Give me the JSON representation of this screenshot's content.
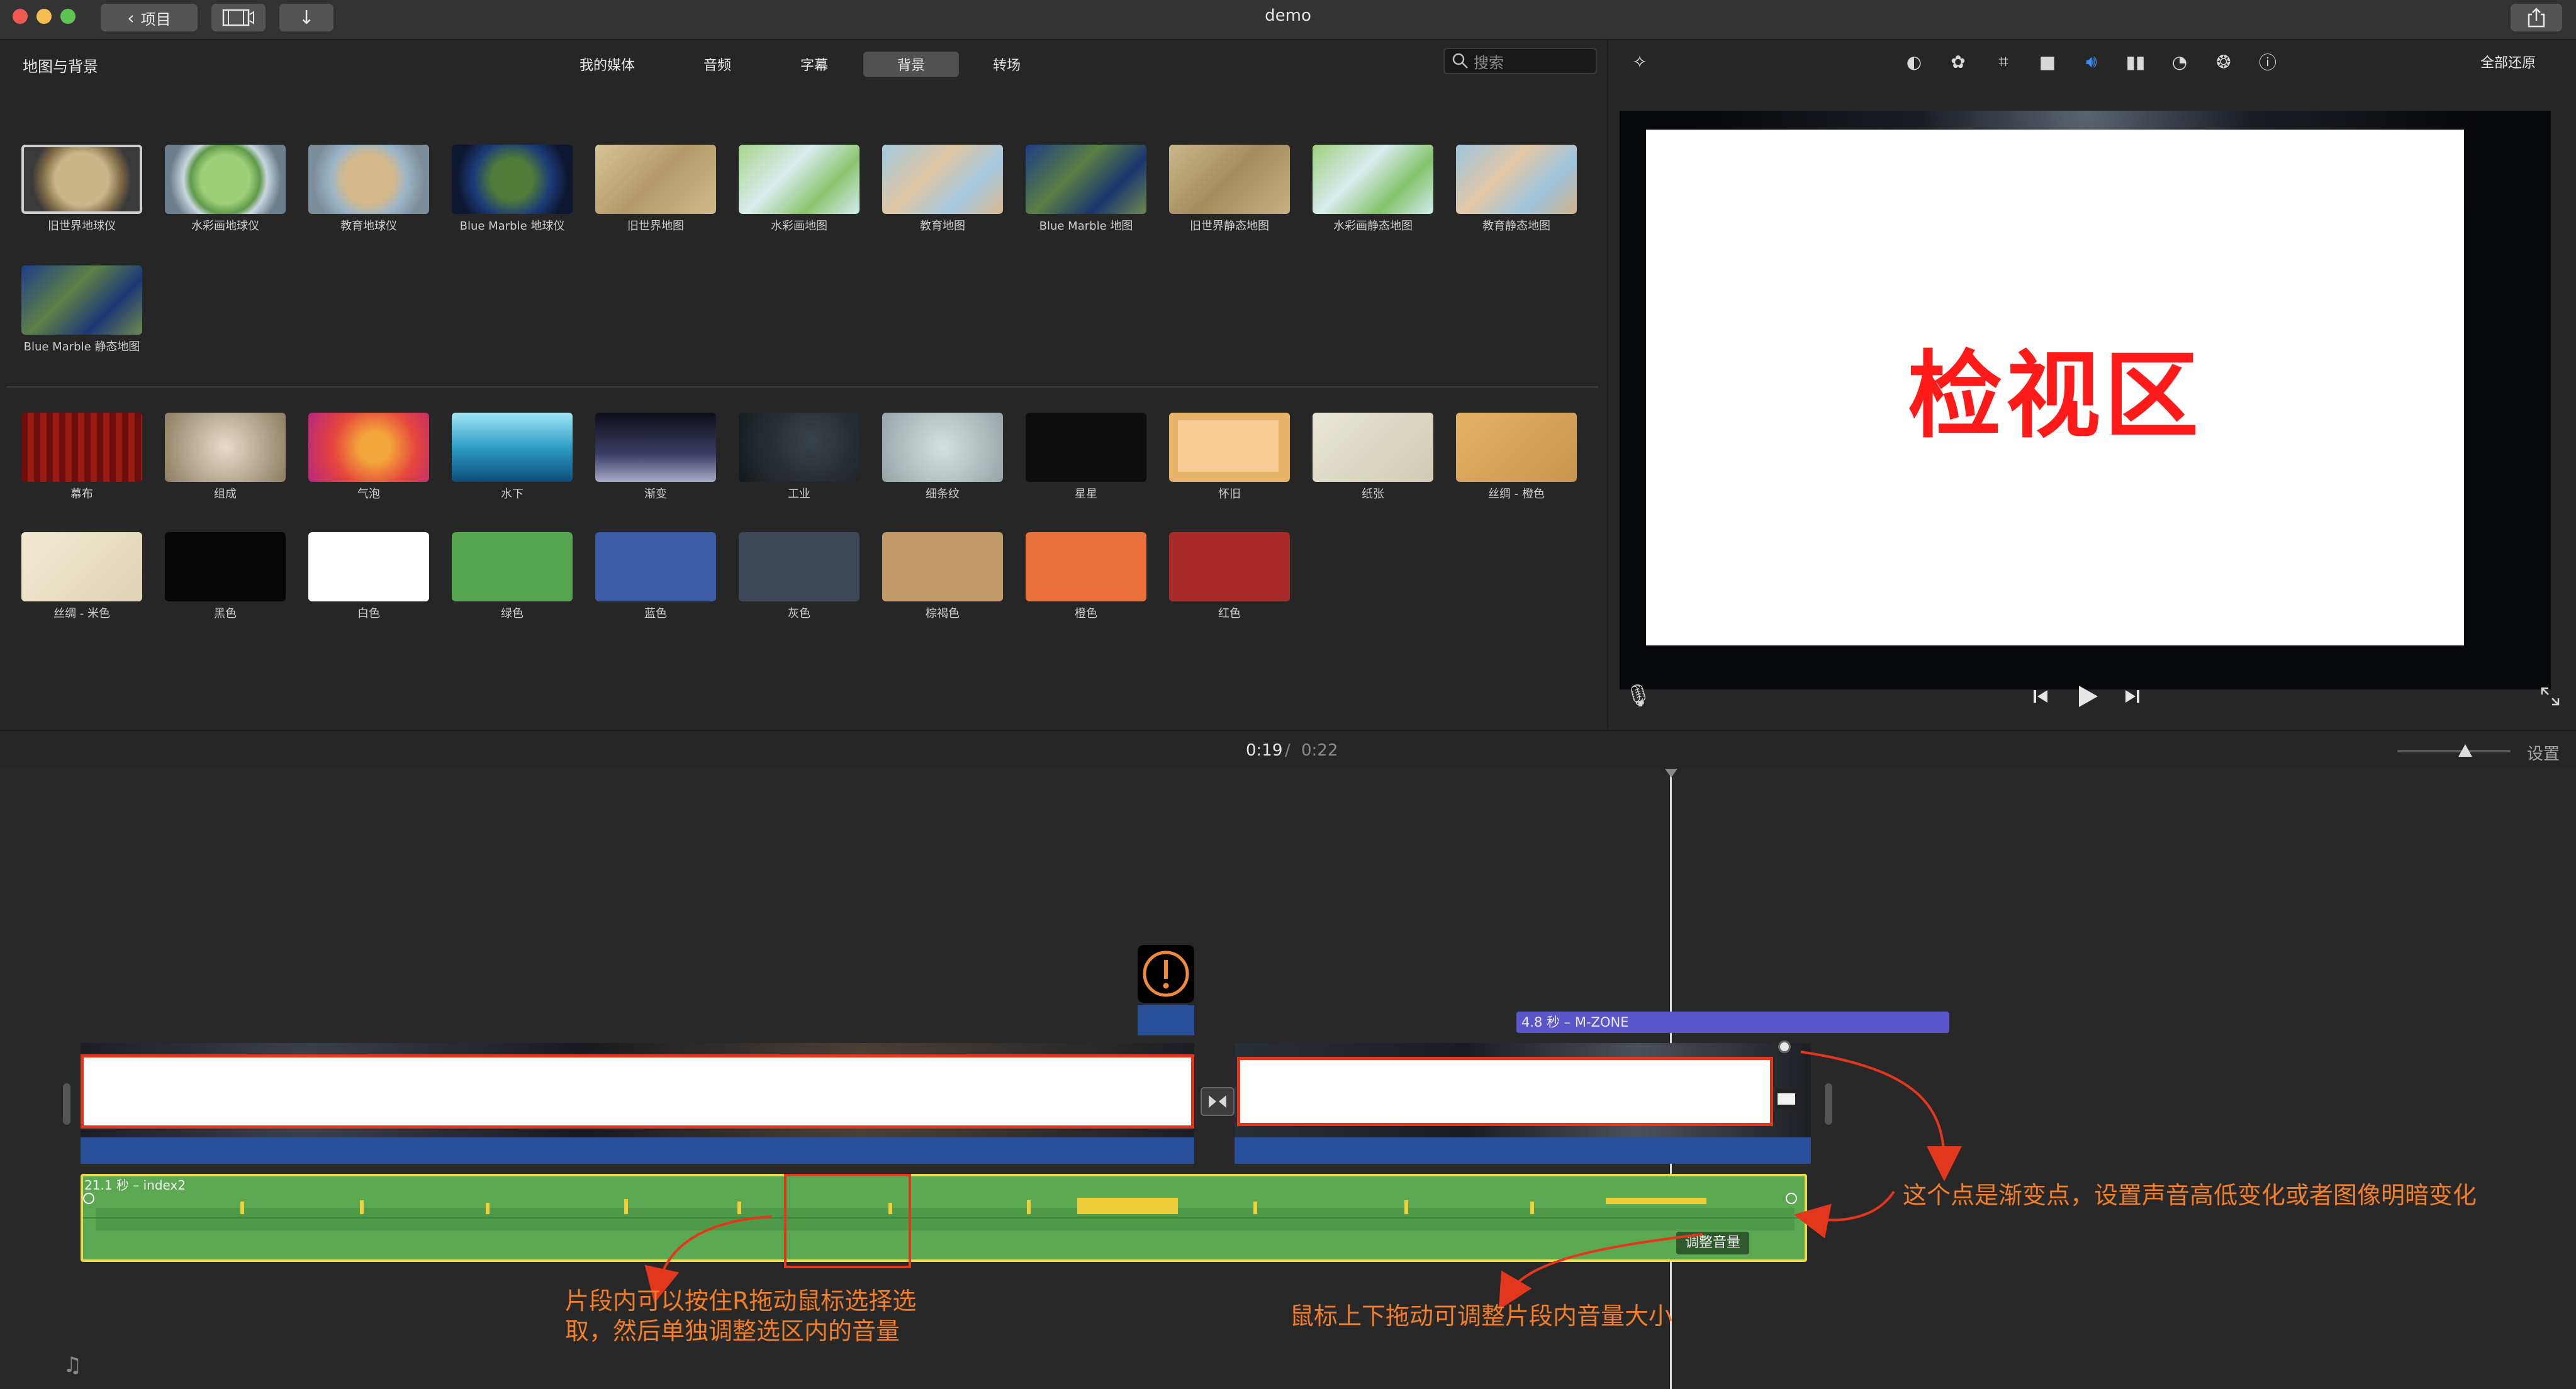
{
  "window": {
    "title": "demo",
    "back_button_label": "项目"
  },
  "browser": {
    "nav_tabs": [
      "我的媒体",
      "音频",
      "字幕",
      "背景",
      "转场"
    ],
    "active_tab": "背景",
    "search_placeholder": "搜索",
    "section_title": "地图与背景",
    "map_items": [
      "旧世界地球仪",
      "水彩画地球仪",
      "教育地球仪",
      "Blue Marble 地球仪",
      "旧世界地图",
      "水彩画地图",
      "教育地图",
      "Blue Marble 地图",
      "旧世界静态地图",
      "水彩画静态地图",
      "教育静态地图",
      "Blue Marble 静态地图"
    ],
    "background_items": [
      "幕布",
      "组成",
      "气泡",
      "水下",
      "渐变",
      "工业",
      "细条纹",
      "星星",
      "怀旧",
      "纸张",
      "丝绸 - 橙色",
      "丝绸 - 米色",
      "黑色",
      "白色",
      "绿色",
      "蓝色",
      "灰色",
      "棕褐色",
      "橙色",
      "红色"
    ]
  },
  "viewer": {
    "restore_all_label": "全部还原",
    "inspection_label": "检视区"
  },
  "timeline": {
    "current_time": "0:19",
    "separator": "/",
    "total_time": "0:22",
    "settings_label": "设置",
    "zoom_level": 0.6,
    "title_clip_label": "4.8 秒 – M-ZONE",
    "audio_clip_label": "21.1 秒 – index2",
    "adjust_volume_label": "调整音量",
    "annotations": {
      "fade_point": "这个点是渐变点，设置声音高低变化或者图像明暗变化",
      "range_select": "片段内可以按住R拖动鼠标选择选取，然后单独调整选区内的音量",
      "drag_volume": "鼠标上下拖动可调整片段内音量大小"
    }
  },
  "colors": {
    "annotation_orange": "#f07e2a",
    "arrow_red": "#e2361d",
    "audio_green": "#5aa950",
    "audio_border": "#e9dc4a",
    "title_purple": "#5a55c8",
    "video_blue": "#2a4f9a",
    "inspection_red": "#ff1a1a"
  }
}
